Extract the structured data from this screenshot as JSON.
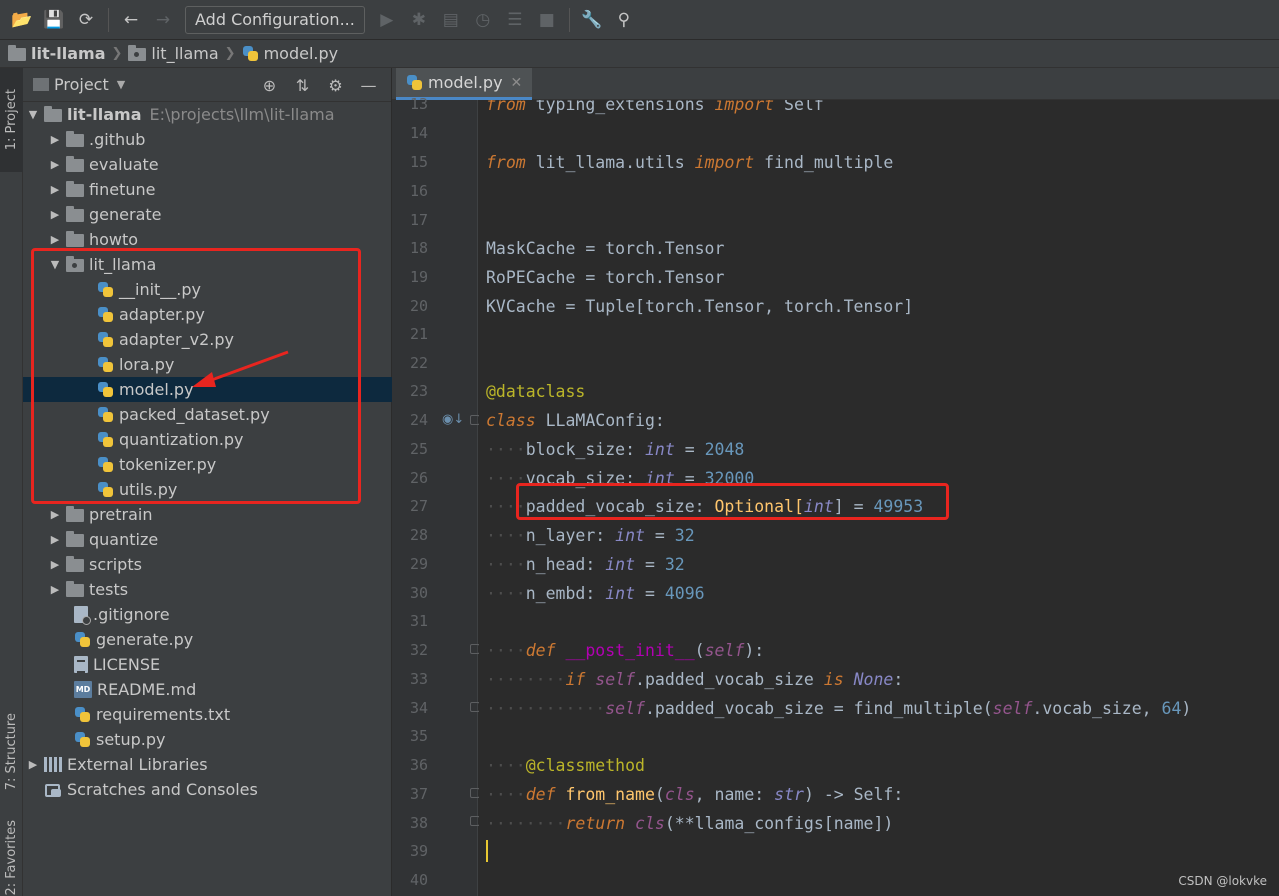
{
  "toolbar": {
    "add_configuration_label": "Add Configuration..."
  },
  "breadcrumb": {
    "items": [
      "lit-llama",
      "lit_llama",
      "model.py"
    ]
  },
  "tool_strip": {
    "project_tab": "1: Project",
    "structure_tab": "7: Structure",
    "favorites_tab": "2: Favorites"
  },
  "project_panel": {
    "title": "Project",
    "root": {
      "name": "lit-llama",
      "path": "E:\\projects\\llm\\lit-llama"
    },
    "items": [
      {
        "label": ".github"
      },
      {
        "label": "evaluate"
      },
      {
        "label": "finetune"
      },
      {
        "label": "generate"
      },
      {
        "label": "howto"
      },
      {
        "label": "lit_llama"
      },
      {
        "label": "__init__.py"
      },
      {
        "label": "adapter.py"
      },
      {
        "label": "adapter_v2.py"
      },
      {
        "label": "lora.py"
      },
      {
        "label": "model.py"
      },
      {
        "label": "packed_dataset.py"
      },
      {
        "label": "quantization.py"
      },
      {
        "label": "tokenizer.py"
      },
      {
        "label": "utils.py"
      },
      {
        "label": "pretrain"
      },
      {
        "label": "quantize"
      },
      {
        "label": "scripts"
      },
      {
        "label": "tests"
      },
      {
        "label": ".gitignore"
      },
      {
        "label": "generate.py"
      },
      {
        "label": "LICENSE"
      },
      {
        "label": "README.md"
      },
      {
        "label": "requirements.txt"
      },
      {
        "label": "setup.py"
      },
      {
        "label": "External Libraries"
      },
      {
        "label": "Scratches and Consoles"
      }
    ]
  },
  "editor": {
    "tab_label": "model.py",
    "line_numbers": [
      "13",
      "14",
      "15",
      "16",
      "17",
      "18",
      "19",
      "20",
      "21",
      "22",
      "23",
      "24",
      "25",
      "26",
      "27",
      "28",
      "29",
      "30",
      "31",
      "32",
      "33",
      "34",
      "35",
      "36",
      "37",
      "38",
      "39",
      "40"
    ],
    "code": {
      "l13_a": "from",
      "l13_b": " typing_extensions ",
      "l13_c": "import",
      "l13_d": " Self",
      "l15_a": "from",
      "l15_b": " lit_llama.utils ",
      "l15_c": "import",
      "l15_d": " find_multiple",
      "l18": "MaskCache = torch.Tensor",
      "l19": "RoPECache = torch.Tensor",
      "l20": "KVCache = Tuple[torch.Tensor, torch.Tensor]",
      "l23": "@dataclass",
      "l24_a": "class",
      "l24_b": " LLaMAConfig:",
      "l25_a": "block_size: ",
      "l25_b": "int",
      "l25_c": " = ",
      "l25_d": "2048",
      "l26_a": "vocab_size: ",
      "l26_b": "int",
      "l26_c": " = ",
      "l26_d": "32000",
      "l27_a": "padded_vocab_size: ",
      "l27_b": "Optional[",
      "l27_c": "int",
      "l27_d": "] = ",
      "l27_e": "49953",
      "l28_a": "n_layer: ",
      "l28_b": "int",
      "l28_c": " = ",
      "l28_d": "32",
      "l29_a": "n_head: ",
      "l29_b": "int",
      "l29_c": " = ",
      "l29_d": "32",
      "l30_a": "n_embd: ",
      "l30_b": "int",
      "l30_c": " = ",
      "l30_d": "4096",
      "l32_a": "def",
      "l32_b": "__post_init__",
      "l32_c": "(",
      "l32_d": "self",
      "l32_e": "):",
      "l33_a": "if",
      "l33_b": "self",
      "l33_c": ".padded_vocab_size ",
      "l33_d": "is",
      "l33_e": " None",
      "l33_f": ":",
      "l34_a": "self",
      "l34_b": ".padded_vocab_size = find_multiple(",
      "l34_c": "self",
      "l34_d": ".vocab_size, ",
      "l34_e": "64",
      "l34_f": ")",
      "l36": "@classmethod",
      "l37_a": "def",
      "l37_b": "from_name",
      "l37_c": "(",
      "l37_d": "cls",
      "l37_e": ", name: ",
      "l37_f": "str",
      "l37_g": ") -> Self:",
      "l38_a": "return",
      "l38_b": "cls",
      "l38_c": "(**llama_configs[name])"
    }
  },
  "watermark": "CSDN @lokvke",
  "colors": {
    "annotation_red": "#e8251f",
    "selection": "#0d293e",
    "tab_underline": "#4a88c7"
  }
}
